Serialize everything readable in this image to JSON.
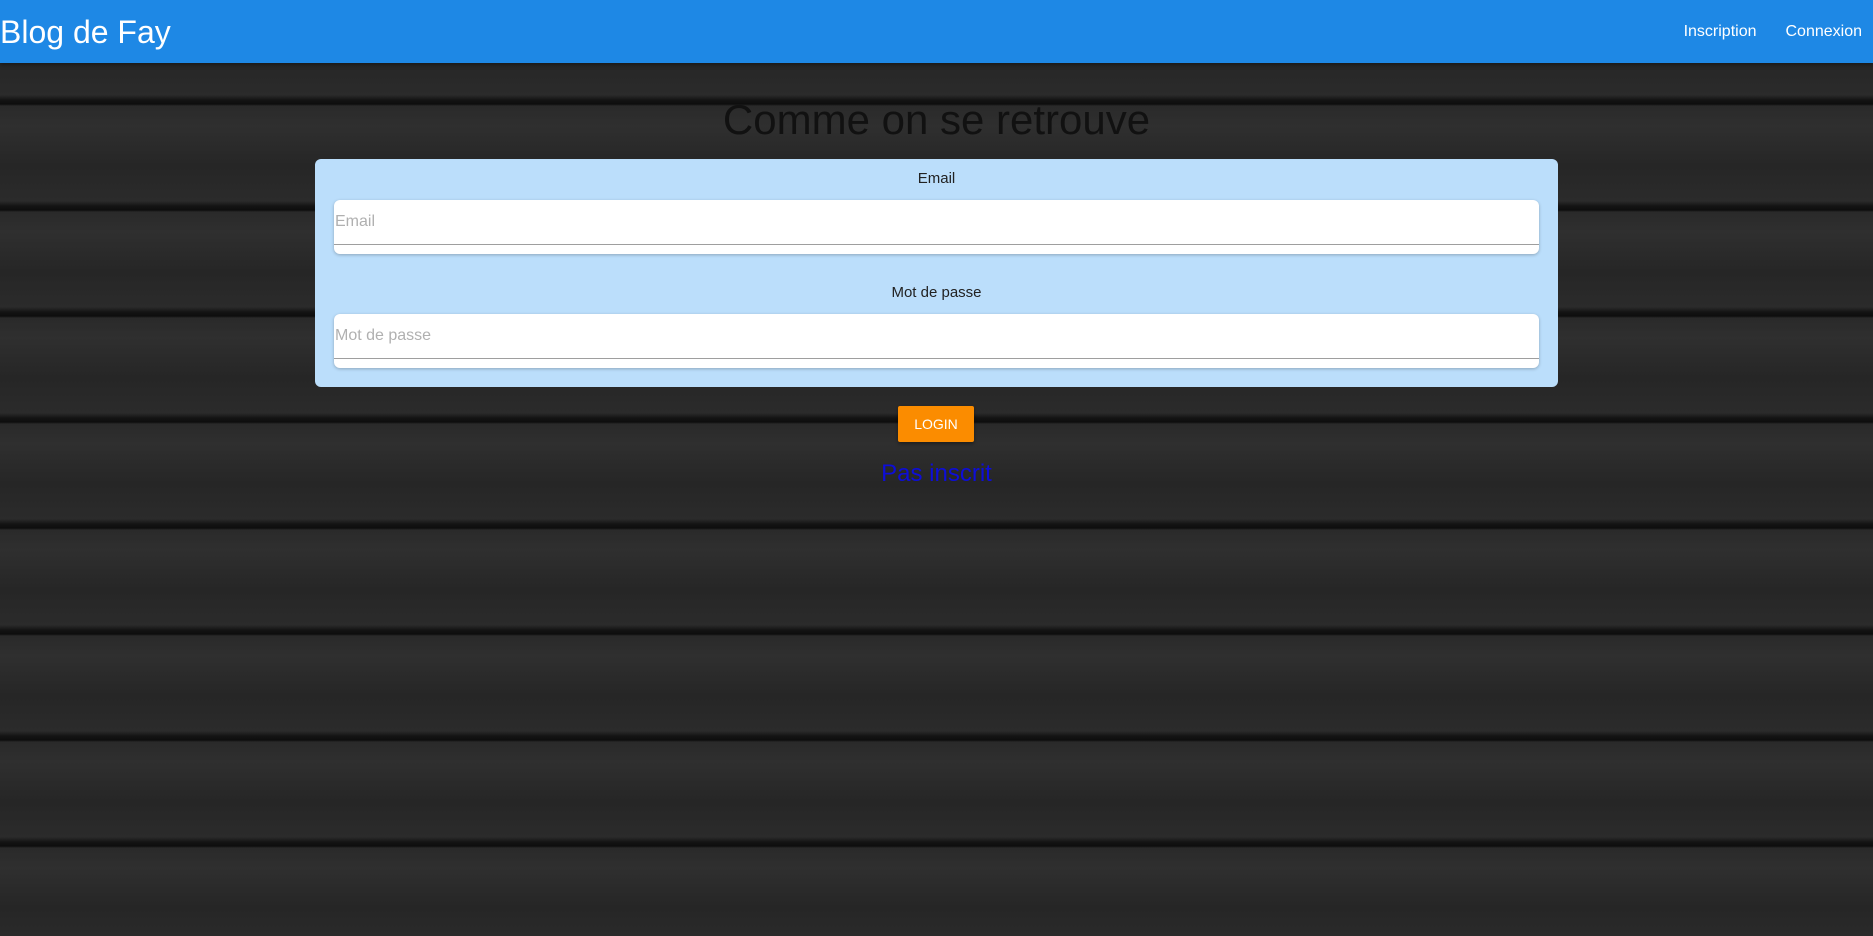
{
  "navbar": {
    "brand": "Blog de Fay",
    "links": [
      {
        "label": "Inscription"
      },
      {
        "label": "Connexion"
      }
    ],
    "color": "#1e88e5"
  },
  "main": {
    "title": "Comme on se retrouve",
    "form": {
      "background": "#bbdefb",
      "email": {
        "label": "Email",
        "placeholder": "Email",
        "value": ""
      },
      "password": {
        "label": "Mot de passe",
        "placeholder": "Mot de passe",
        "value": ""
      }
    },
    "login_button": {
      "label": "Login",
      "color": "#fb8c00"
    },
    "signup_link": "Pas inscrit"
  }
}
